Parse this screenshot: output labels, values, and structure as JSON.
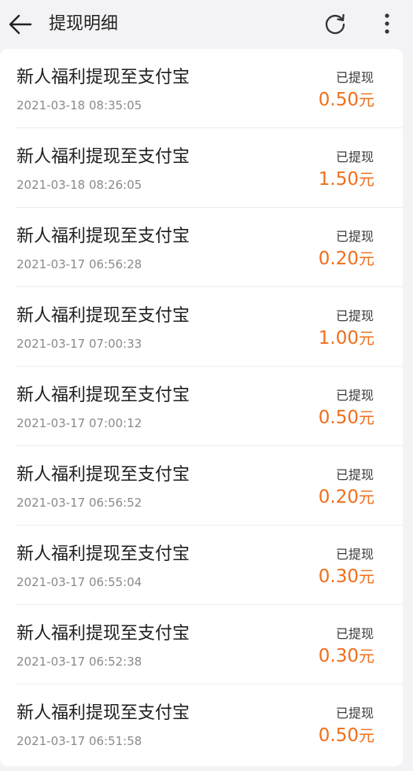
{
  "header": {
    "title": "提现明细",
    "icons": {
      "back": "arrow-left-icon",
      "refresh": "refresh-icon",
      "more": "more-vertical-icon"
    }
  },
  "colors": {
    "background": "#f3f3f5",
    "card": "#ffffff",
    "amount": "#f06e1c",
    "title_text": "#1e1e1e",
    "secondary_text": "#8a8a8a"
  },
  "records": [
    {
      "title": "新人福利提现至支付宝",
      "time": "2021-03-18 08:35:05",
      "status": "已提现",
      "amount": "0.50",
      "unit": "元"
    },
    {
      "title": "新人福利提现至支付宝",
      "time": "2021-03-18 08:26:05",
      "status": "已提现",
      "amount": "1.50",
      "unit": "元"
    },
    {
      "title": "新人福利提现至支付宝",
      "time": "2021-03-17 06:56:28",
      "status": "已提现",
      "amount": "0.20",
      "unit": "元"
    },
    {
      "title": "新人福利提现至支付宝",
      "time": "2021-03-17 07:00:33",
      "status": "已提现",
      "amount": "1.00",
      "unit": "元"
    },
    {
      "title": "新人福利提现至支付宝",
      "time": "2021-03-17 07:00:12",
      "status": "已提现",
      "amount": "0.50",
      "unit": "元"
    },
    {
      "title": "新人福利提现至支付宝",
      "time": "2021-03-17 06:56:52",
      "status": "已提现",
      "amount": "0.20",
      "unit": "元"
    },
    {
      "title": "新人福利提现至支付宝",
      "time": "2021-03-17 06:55:04",
      "status": "已提现",
      "amount": "0.30",
      "unit": "元"
    },
    {
      "title": "新人福利提现至支付宝",
      "time": "2021-03-17 06:52:38",
      "status": "已提现",
      "amount": "0.30",
      "unit": "元"
    },
    {
      "title": "新人福利提现至支付宝",
      "time": "2021-03-17 06:51:58",
      "status": "已提现",
      "amount": "0.50",
      "unit": "元"
    }
  ]
}
